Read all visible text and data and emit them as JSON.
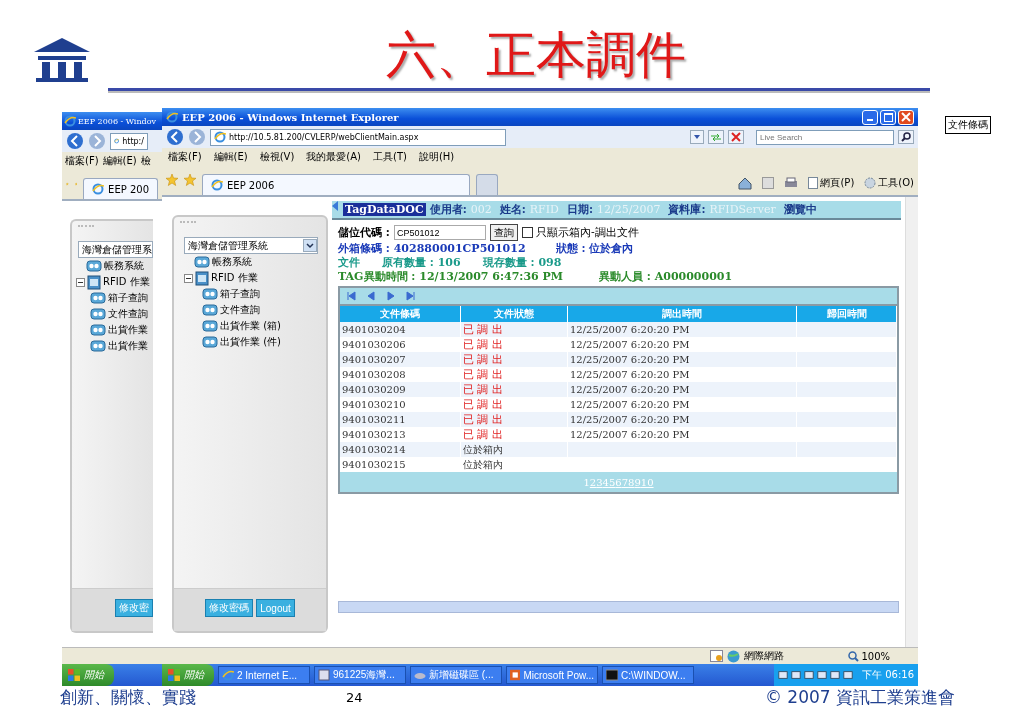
{
  "slide": {
    "title": "六、正本調件",
    "side_label": "文件條碼",
    "footer_motto": "創新、關懷、實踐",
    "page_number": "24",
    "copyright": "© 2007 資訊工業策進會"
  },
  "back_window": {
    "title": "EEP 2006 - Windov",
    "address": "http:/",
    "menus": [
      "檔案(F)",
      "編輯(E)",
      "檢"
    ],
    "tab": "EEP 200",
    "tree_select": "海灣倉儲管理系",
    "tree": [
      {
        "label": "帳務系統"
      },
      {
        "label": "RFID 作業",
        "expanded": true,
        "children": [
          {
            "label": "箱子查詢"
          },
          {
            "label": "文件查詢"
          },
          {
            "label": "出貨作業"
          },
          {
            "label": "出貨作業"
          }
        ]
      }
    ],
    "button": "修改密",
    "start": "開始"
  },
  "window": {
    "title": "EEP 2006 - Windows Internet Explorer",
    "address": "http://10.5.81.200/CVLERP/webClientMain.aspx",
    "search_placeholder": "Live Search",
    "menus": [
      "檔案(F)",
      "編輯(E)",
      "檢視(V)",
      "我的最愛(A)",
      "工具(T)",
      "說明(H)"
    ],
    "tab": "EEP 2006",
    "toolbar": [
      "網頁(P)",
      "工具(O)"
    ]
  },
  "sidebar": {
    "select": "海灣倉儲管理系統",
    "tree": [
      {
        "label": "帳務系統"
      },
      {
        "label": "RFID 作業",
        "expanded": true,
        "children": [
          {
            "label": "箱子查詢"
          },
          {
            "label": "文件查詢"
          },
          {
            "label": "出貨作業 (箱)"
          },
          {
            "label": "出貨作業 (件)"
          }
        ]
      }
    ],
    "buttons": [
      "修改密碼",
      "Logout"
    ]
  },
  "header": {
    "tag": "TagDataDOC",
    "fields": [
      {
        "label": "使用者:",
        "value": "002"
      },
      {
        "label": "姓名:",
        "value": "RFID"
      },
      {
        "label": "日期:",
        "value": "12/25/2007"
      },
      {
        "label": "資料庫:",
        "value": "RFIDServer"
      }
    ],
    "mode": "瀏覽中"
  },
  "form": {
    "label": "儲位代碼 :",
    "value": "CP501012",
    "button": "查詢",
    "checkbox": {
      "label": "只顯示箱內-調出文件",
      "checked": false
    }
  },
  "info_lines": [
    {
      "kind": "barcode",
      "parts": [
        "外箱條碼 : 402880001CP501012",
        "狀態 : 位於倉內"
      ]
    },
    {
      "kind": "count",
      "parts": [
        "文件",
        "原有數量 : 106",
        "現存數量 : 098"
      ]
    },
    {
      "kind": "tag",
      "parts": [
        "TAG異動時間 : 12/13/2007 6:47:36 PM",
        "異動人員 : A000000001"
      ]
    }
  ],
  "table": {
    "columns": [
      "文件條碼",
      "文件狀態",
      "調出時間",
      "歸回時間"
    ],
    "rows": [
      {
        "code": "9401030204",
        "status": "已 調 出",
        "kind": "out",
        "out_time": "12/25/2007 6:20:20 PM"
      },
      {
        "code": "9401030206",
        "status": "已 調 出",
        "kind": "out",
        "out_time": "12/25/2007 6:20:20 PM"
      },
      {
        "code": "9401030207",
        "status": "已 調 出",
        "kind": "out",
        "out_time": "12/25/2007 6:20:20 PM"
      },
      {
        "code": "9401030208",
        "status": "已 調 出",
        "kind": "out",
        "out_time": "12/25/2007 6:20:20 PM"
      },
      {
        "code": "9401030209",
        "status": "已 調 出",
        "kind": "out",
        "out_time": "12/25/2007 6:20:20 PM"
      },
      {
        "code": "9401030210",
        "status": "已 調 出",
        "kind": "out",
        "out_time": "12/25/2007 6:20:20 PM"
      },
      {
        "code": "9401030211",
        "status": "已 調 出",
        "kind": "out",
        "out_time": "12/25/2007 6:20:20 PM"
      },
      {
        "code": "9401030213",
        "status": "已 調 出",
        "kind": "out",
        "out_time": "12/25/2007 6:20:20 PM"
      },
      {
        "code": "9401030214",
        "status": "位於箱內",
        "kind": "in"
      },
      {
        "code": "9401030215",
        "status": "位於箱內",
        "kind": "in"
      }
    ],
    "pages": [
      {
        "label": "1",
        "selected": true
      },
      {
        "label": "2",
        "selected": false
      },
      {
        "label": "3",
        "selected": false
      },
      {
        "label": "4",
        "selected": false
      },
      {
        "label": "5",
        "selected": false
      },
      {
        "label": "6",
        "selected": false
      },
      {
        "label": "7",
        "selected": false
      },
      {
        "label": "8",
        "selected": false
      },
      {
        "label": "9",
        "selected": false
      },
      {
        "label": "10",
        "selected": false
      }
    ]
  },
  "status_bar": {
    "zone": "網際網路",
    "zoom": "100%"
  },
  "taskbar": {
    "start": "開始",
    "items": [
      "2 Internet E...",
      "961225海灣...",
      "新增磁碟區 (...",
      "Microsoft Pow...",
      "C:\\WINDOW..."
    ],
    "clock": "下午 06:16"
  }
}
